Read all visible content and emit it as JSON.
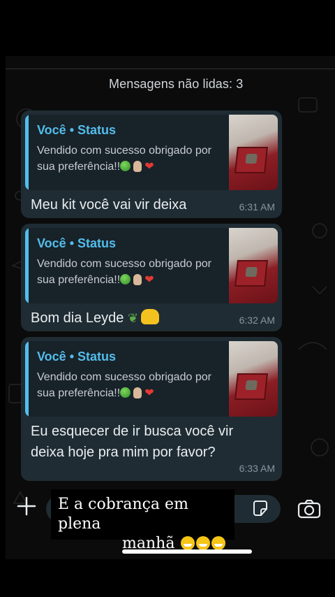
{
  "chat": {
    "unread_label": "Mensagens não lidas: 3",
    "messages": [
      {
        "quote_author": "Você • Status",
        "quote_text": "Vendido com sucesso obrigado por sua preferência!!",
        "text": "Meu kit você vai vir deixa",
        "time": "6:31 AM"
      },
      {
        "quote_author": "Você • Status",
        "quote_text": "Vendido com sucesso obrigado por sua preferência!!",
        "text": "Bom dia Leyde",
        "time": "6:32 AM"
      },
      {
        "quote_author": "Você • Status",
        "quote_text": "Vendido com sucesso obrigado por sua preferência!!",
        "text": "Eu esquecer de ir busca você vir deixa hoje pra mim por favor?",
        "time": "6:33 AM"
      }
    ]
  },
  "input_bar": {
    "icons": [
      "plus-icon",
      "sticker-icon",
      "camera-icon"
    ]
  },
  "caption": {
    "line1": "E a cobrança  em plena",
    "line2": "manhã"
  },
  "colors": {
    "accent": "#53bdeb",
    "bubble": "#1f2c34",
    "quote_bg": "#182229"
  }
}
